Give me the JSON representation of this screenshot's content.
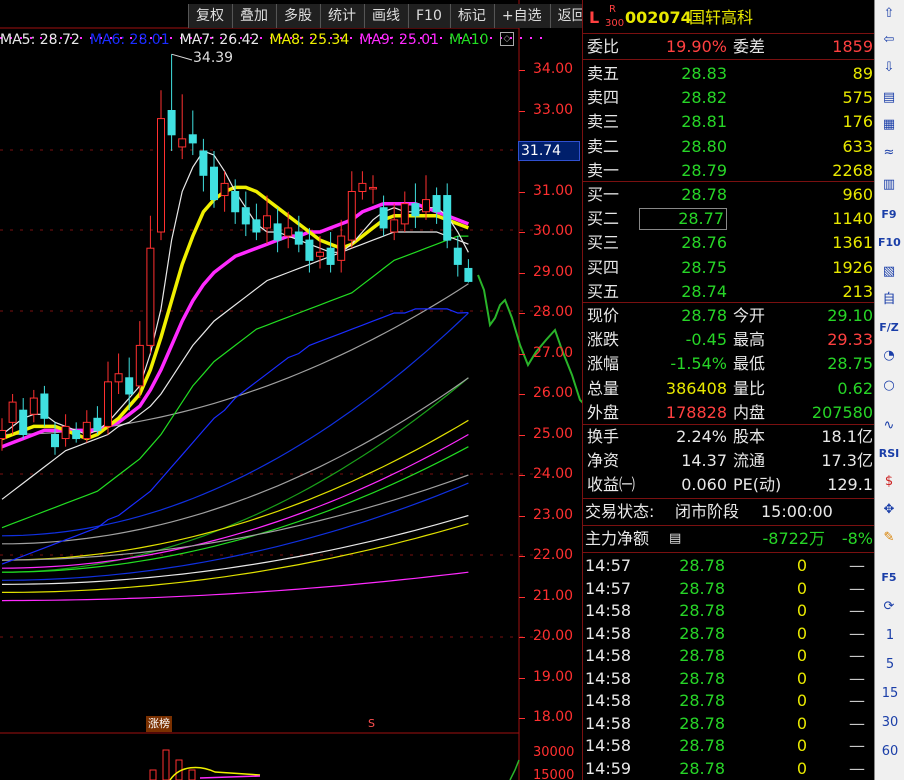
{
  "toolbar": [
    "复权",
    "叠加",
    "多股",
    "统计",
    "画线",
    "F10",
    "标记",
    "+自选",
    "返回"
  ],
  "ma_legend": [
    {
      "label": "MA5: 28.72",
      "color": "#e8e8e8"
    },
    {
      "label": "MA6: 28.01",
      "color": "#1a2cff"
    },
    {
      "label": "MA7: 26.42",
      "color": "#e8e8e8"
    },
    {
      "label": "MA8: 25.34",
      "color": "#f0f000"
    },
    {
      "label": "MA9: 25.01",
      "color": "#ff2aff"
    },
    {
      "label": "MA10",
      "color": "#22dd22"
    }
  ],
  "chart_data": {
    "type": "candlestick",
    "ylim": [
      18.0,
      34.39
    ],
    "y_ticks": [
      "34.00",
      "33.00",
      "32.00",
      "31.00",
      "30.00",
      "29.00",
      "28.00",
      "27.00",
      "26.00",
      "25.00",
      "24.00",
      "23.00",
      "22.00",
      "21.00",
      "20.00",
      "19.00",
      "18.00"
    ],
    "current_price_marker": "31.74",
    "peak_label": "34.39",
    "volume_ticks": [
      "30000",
      "15000"
    ],
    "tags": [
      "涨榜",
      "S"
    ],
    "candles": [
      {
        "o": 24.9,
        "c": 25.1,
        "h": 25.4,
        "l": 24.6
      },
      {
        "o": 25.3,
        "c": 25.8,
        "h": 26.0,
        "l": 25.0
      },
      {
        "o": 25.6,
        "c": 25.0,
        "h": 25.9,
        "l": 24.9
      },
      {
        "o": 25.5,
        "c": 25.9,
        "h": 26.1,
        "l": 25.3
      },
      {
        "o": 26.0,
        "c": 25.4,
        "h": 26.2,
        "l": 25.2
      },
      {
        "o": 25.0,
        "c": 24.7,
        "h": 25.3,
        "l": 24.5
      },
      {
        "o": 24.9,
        "c": 25.2,
        "h": 25.5,
        "l": 24.7
      },
      {
        "o": 25.1,
        "c": 24.9,
        "h": 25.3,
        "l": 24.8
      },
      {
        "o": 24.9,
        "c": 25.3,
        "h": 25.6,
        "l": 24.8
      },
      {
        "o": 25.4,
        "c": 25.1,
        "h": 25.7,
        "l": 25.0
      },
      {
        "o": 25.2,
        "c": 26.3,
        "h": 26.8,
        "l": 25.0
      },
      {
        "o": 26.3,
        "c": 26.5,
        "h": 27.0,
        "l": 26.0
      },
      {
        "o": 26.4,
        "c": 26.0,
        "h": 26.9,
        "l": 25.6
      },
      {
        "o": 26.2,
        "c": 27.2,
        "h": 27.8,
        "l": 25.9
      },
      {
        "o": 27.2,
        "c": 29.6,
        "h": 30.4,
        "l": 27.0
      },
      {
        "o": 30.0,
        "c": 32.8,
        "h": 33.5,
        "l": 29.8
      },
      {
        "o": 33.0,
        "c": 32.4,
        "h": 34.39,
        "l": 32.0
      },
      {
        "o": 32.1,
        "c": 32.3,
        "h": 33.4,
        "l": 31.8
      },
      {
        "o": 32.4,
        "c": 32.2,
        "h": 33.0,
        "l": 31.9
      },
      {
        "o": 32.0,
        "c": 31.4,
        "h": 32.3,
        "l": 31.0
      },
      {
        "o": 31.6,
        "c": 30.8,
        "h": 32.0,
        "l": 30.6
      },
      {
        "o": 30.9,
        "c": 31.2,
        "h": 31.5,
        "l": 30.5
      },
      {
        "o": 31.0,
        "c": 30.5,
        "h": 31.3,
        "l": 30.2
      },
      {
        "o": 30.6,
        "c": 30.2,
        "h": 31.0,
        "l": 29.9
      },
      {
        "o": 30.3,
        "c": 30.0,
        "h": 30.7,
        "l": 29.8
      },
      {
        "o": 30.1,
        "c": 30.4,
        "h": 30.9,
        "l": 29.7
      },
      {
        "o": 30.2,
        "c": 29.8,
        "h": 30.6,
        "l": 29.5
      },
      {
        "o": 29.9,
        "c": 30.1,
        "h": 30.5,
        "l": 29.6
      },
      {
        "o": 30.0,
        "c": 29.7,
        "h": 30.4,
        "l": 29.5
      },
      {
        "o": 29.8,
        "c": 29.3,
        "h": 30.1,
        "l": 29.0
      },
      {
        "o": 29.4,
        "c": 29.5,
        "h": 29.9,
        "l": 29.1
      },
      {
        "o": 29.6,
        "c": 29.2,
        "h": 30.0,
        "l": 29.0
      },
      {
        "o": 29.3,
        "c": 29.9,
        "h": 30.3,
        "l": 29.0
      },
      {
        "o": 29.8,
        "c": 31.0,
        "h": 31.5,
        "l": 29.6
      },
      {
        "o": 31.0,
        "c": 31.2,
        "h": 31.5,
        "l": 30.8
      },
      {
        "o": 31.1,
        "c": 31.1,
        "h": 31.4,
        "l": 30.7
      },
      {
        "o": 30.6,
        "c": 30.1,
        "h": 30.9,
        "l": 29.9
      },
      {
        "o": 30.0,
        "c": 30.3,
        "h": 30.7,
        "l": 29.8
      },
      {
        "o": 30.2,
        "c": 30.7,
        "h": 31.0,
        "l": 30.0
      },
      {
        "o": 30.7,
        "c": 30.4,
        "h": 31.2,
        "l": 30.1
      },
      {
        "o": 30.5,
        "c": 30.8,
        "h": 31.4,
        "l": 30.3
      },
      {
        "o": 30.9,
        "c": 30.5,
        "h": 31.1,
        "l": 30.2
      },
      {
        "o": 30.9,
        "c": 29.8,
        "h": 31.2,
        "l": 29.6
      },
      {
        "o": 29.6,
        "c": 29.2,
        "h": 29.9,
        "l": 28.9
      },
      {
        "o": 29.1,
        "c": 28.78,
        "h": 29.33,
        "l": 28.75
      }
    ],
    "ma_lines": {
      "MA5": [
        25.0,
        25.2,
        25.4,
        25.5,
        25.5,
        25.3,
        25.2,
        25.1,
        25.0,
        25.1,
        25.3,
        25.6,
        25.9,
        26.2,
        27.0,
        28.1,
        29.8,
        31.0,
        31.6,
        32.0,
        31.9,
        31.5,
        31.0,
        30.6,
        30.2,
        30.0,
        30.0,
        29.9,
        29.8,
        29.7,
        29.6,
        29.5,
        29.5,
        29.7,
        30.0,
        30.3,
        30.5,
        30.6,
        30.5,
        30.5,
        30.6,
        30.6,
        30.4,
        30.0,
        29.5
      ],
      "MA6": [
        21.8,
        21.9,
        22.0,
        22.1,
        22.2,
        22.3,
        22.4,
        22.5,
        22.6,
        22.7,
        22.9,
        23.0,
        23.2,
        23.4,
        23.6,
        23.9,
        24.2,
        24.5,
        24.8,
        25.1,
        25.4,
        25.6,
        25.9,
        26.1,
        26.3,
        26.5,
        26.7,
        26.9,
        27.0,
        27.2,
        27.3,
        27.4,
        27.5,
        27.6,
        27.7,
        27.8,
        27.9,
        28.0,
        28.0,
        28.1,
        28.1,
        28.1,
        28.1,
        28.0,
        28.01
      ],
      "MA7": [
        23.4,
        23.6,
        23.8,
        24.0,
        24.2,
        24.4,
        24.6,
        24.7,
        24.8,
        24.9,
        25.0,
        25.2,
        25.3,
        25.5,
        25.7,
        26.0,
        26.4,
        26.8,
        27.2,
        27.5,
        27.8,
        28.0,
        28.2,
        28.4,
        28.6,
        28.8,
        28.9,
        29.0,
        29.1,
        29.2,
        29.3,
        29.4,
        29.5,
        29.6,
        29.7,
        29.8,
        29.9,
        30.0,
        30.0,
        30.0,
        30.0,
        30.0,
        29.9,
        29.8,
        29.7
      ],
      "MA8": [
        24.9,
        25.0,
        25.1,
        25.2,
        25.2,
        25.2,
        25.1,
        25.0,
        24.9,
        25.0,
        25.2,
        25.4,
        25.7,
        26.0,
        26.6,
        27.4,
        28.3,
        29.2,
        29.9,
        30.5,
        30.8,
        31.0,
        31.1,
        31.1,
        31.0,
        30.8,
        30.6,
        30.4,
        30.2,
        30.0,
        29.8,
        29.7,
        29.6,
        29.7,
        29.9,
        30.1,
        30.3,
        30.4,
        30.4,
        30.4,
        30.4,
        30.4,
        30.3,
        30.2,
        30.1
      ],
      "MA9": [
        24.7,
        24.8,
        24.9,
        25.0,
        25.1,
        25.1,
        25.1,
        25.1,
        25.1,
        25.1,
        25.2,
        25.3,
        25.5,
        25.7,
        26.1,
        26.6,
        27.2,
        27.8,
        28.3,
        28.7,
        29.0,
        29.2,
        29.4,
        29.5,
        29.6,
        29.7,
        29.8,
        29.9,
        29.9,
        30.0,
        30.0,
        30.1,
        30.2,
        30.3,
        30.5,
        30.6,
        30.7,
        30.7,
        30.7,
        30.7,
        30.6,
        30.5,
        30.4,
        30.3,
        30.2
      ],
      "MA10": [
        22.7,
        22.8,
        22.9,
        23.0,
        23.1,
        23.2,
        23.3,
        23.4,
        23.5,
        23.6,
        23.8,
        24.0,
        24.2,
        24.4,
        24.7,
        25.0,
        25.4,
        25.8,
        26.2,
        26.5,
        26.8,
        27.0,
        27.2,
        27.4,
        27.6,
        27.7,
        27.8,
        27.9,
        28.0,
        28.1,
        28.2,
        28.3,
        28.4,
        28.5,
        28.7,
        28.9,
        29.1,
        29.3,
        29.4,
        29.5,
        29.6,
        29.7,
        29.8,
        29.9,
        29.9
      ]
    }
  },
  "stock": {
    "market": "L",
    "flag1": "R",
    "flag2": "300",
    "code": "002074",
    "name": "国轩高科"
  },
  "weibi": {
    "label1": "委比",
    "value1": "19.90%",
    "label2": "委差",
    "value2": "1859"
  },
  "sell_orders": [
    {
      "label": "卖五",
      "price": "28.83",
      "vol": "89"
    },
    {
      "label": "卖四",
      "price": "28.82",
      "vol": "575"
    },
    {
      "label": "卖三",
      "price": "28.81",
      "vol": "176"
    },
    {
      "label": "卖二",
      "price": "28.80",
      "vol": "633"
    },
    {
      "label": "卖一",
      "price": "28.79",
      "vol": "2268"
    }
  ],
  "buy_orders": [
    {
      "label": "买一",
      "price": "28.78",
      "vol": "960"
    },
    {
      "label": "买二",
      "price": "28.77",
      "vol": "1140"
    },
    {
      "label": "买三",
      "price": "28.76",
      "vol": "1361"
    },
    {
      "label": "买四",
      "price": "28.75",
      "vol": "1926"
    },
    {
      "label": "买五",
      "price": "28.74",
      "vol": "213"
    }
  ],
  "stats": [
    {
      "l1": "现价",
      "v1": "28.78",
      "c1": "green",
      "l2": "今开",
      "v2": "29.10",
      "c2": "green"
    },
    {
      "l1": "涨跌",
      "v1": "-0.45",
      "c1": "green",
      "l2": "最高",
      "v2": "29.33",
      "c2": "red"
    },
    {
      "l1": "涨幅",
      "v1": "-1.54%",
      "c1": "green",
      "l2": "最低",
      "v2": "28.75",
      "c2": "green"
    },
    {
      "l1": "总量",
      "v1": "386408",
      "c1": "yel",
      "l2": "量比",
      "v2": "0.62",
      "c2": "green"
    },
    {
      "l1": "外盘",
      "v1": "178828",
      "c1": "red",
      "l2": "内盘",
      "v2": "207580",
      "c2": "green"
    }
  ],
  "fundamentals": [
    {
      "l1": "换手",
      "v1": "2.24%",
      "l2": "股本",
      "v2": "18.1亿"
    },
    {
      "l1": "净资",
      "v1": "14.37",
      "l2": "流通",
      "v2": "17.3亿"
    },
    {
      "l1": "收益㈠",
      "v1": "0.060",
      "l2": "PE(动)",
      "v2": "129.1"
    }
  ],
  "status": {
    "label": "交易状态:",
    "value": "闭市阶段",
    "time": "15:00:00"
  },
  "main_force": {
    "label": "主力净额",
    "value": "-8722万",
    "pct": "-8%"
  },
  "ticks": [
    {
      "time": "14:57",
      "price": "28.78",
      "vol": "0",
      "dir": "—"
    },
    {
      "time": "14:57",
      "price": "28.78",
      "vol": "0",
      "dir": "—"
    },
    {
      "time": "14:58",
      "price": "28.78",
      "vol": "0",
      "dir": "—"
    },
    {
      "time": "14:58",
      "price": "28.78",
      "vol": "0",
      "dir": "—"
    },
    {
      "time": "14:58",
      "price": "28.78",
      "vol": "0",
      "dir": "—"
    },
    {
      "time": "14:58",
      "price": "28.78",
      "vol": "0",
      "dir": "—"
    },
    {
      "time": "14:58",
      "price": "28.78",
      "vol": "0",
      "dir": "—"
    },
    {
      "time": "14:58",
      "price": "28.78",
      "vol": "0",
      "dir": "—"
    },
    {
      "time": "14:58",
      "price": "28.78",
      "vol": "0",
      "dir": "—"
    },
    {
      "time": "14:59",
      "price": "28.78",
      "vol": "0",
      "dir": "—"
    }
  ],
  "side_icons": [
    "up-arrow-icon",
    "left-arrow-icon",
    "down-arrow-icon",
    "chart-doc-icon",
    "table-icon",
    "line-chart-icon",
    "candle-icon",
    "f9-icon",
    "f10-icon",
    "doc-icon",
    "self-icon",
    "fiz-icon",
    "pie-icon",
    "circle-icon",
    "wave-icon",
    "rsi-icon",
    "dollar-icon",
    "move-icon",
    "pencil-icon",
    "f5-icon",
    "refresh-icon"
  ],
  "side_nums": [
    "1",
    "5",
    "15",
    "30",
    "60"
  ],
  "side_texts": [
    "RSI",
    "$",
    "F5"
  ]
}
